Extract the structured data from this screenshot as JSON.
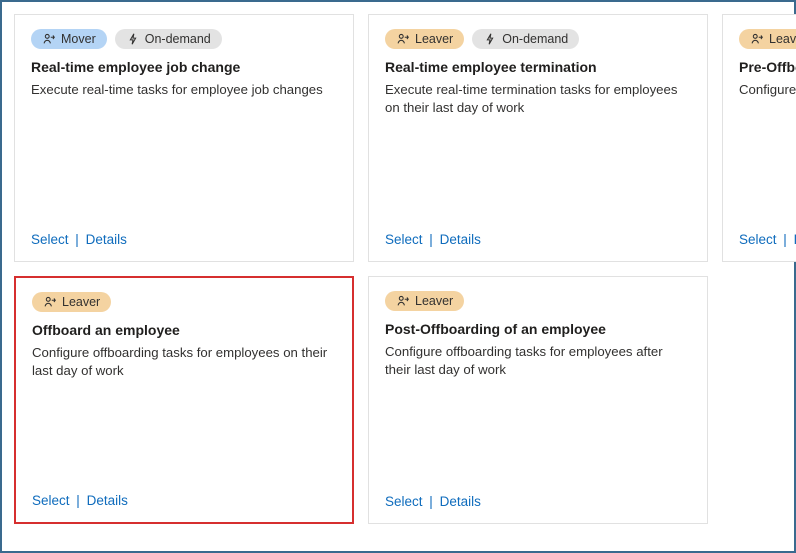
{
  "badges": {
    "mover": "Mover",
    "leaver": "Leaver",
    "ondemand": "On-demand"
  },
  "actions": {
    "select": "Select",
    "details": "Details"
  },
  "cards": [
    {
      "title": "Real-time employee job change",
      "desc": "Execute real-time tasks for employee job changes"
    },
    {
      "title": "Real-time employee termination",
      "desc": "Execute real-time termination tasks for employees on their last day of work"
    },
    {
      "title": "Pre-Offboard",
      "desc": "Configure pre offboarding tasks before their last day"
    },
    {
      "title": "Offboard an employee",
      "desc": "Configure offboarding tasks for employees on their last day of work"
    },
    {
      "title": "Post-Offboarding of an employee",
      "desc": "Configure offboarding tasks for employees after their last day of work"
    }
  ]
}
